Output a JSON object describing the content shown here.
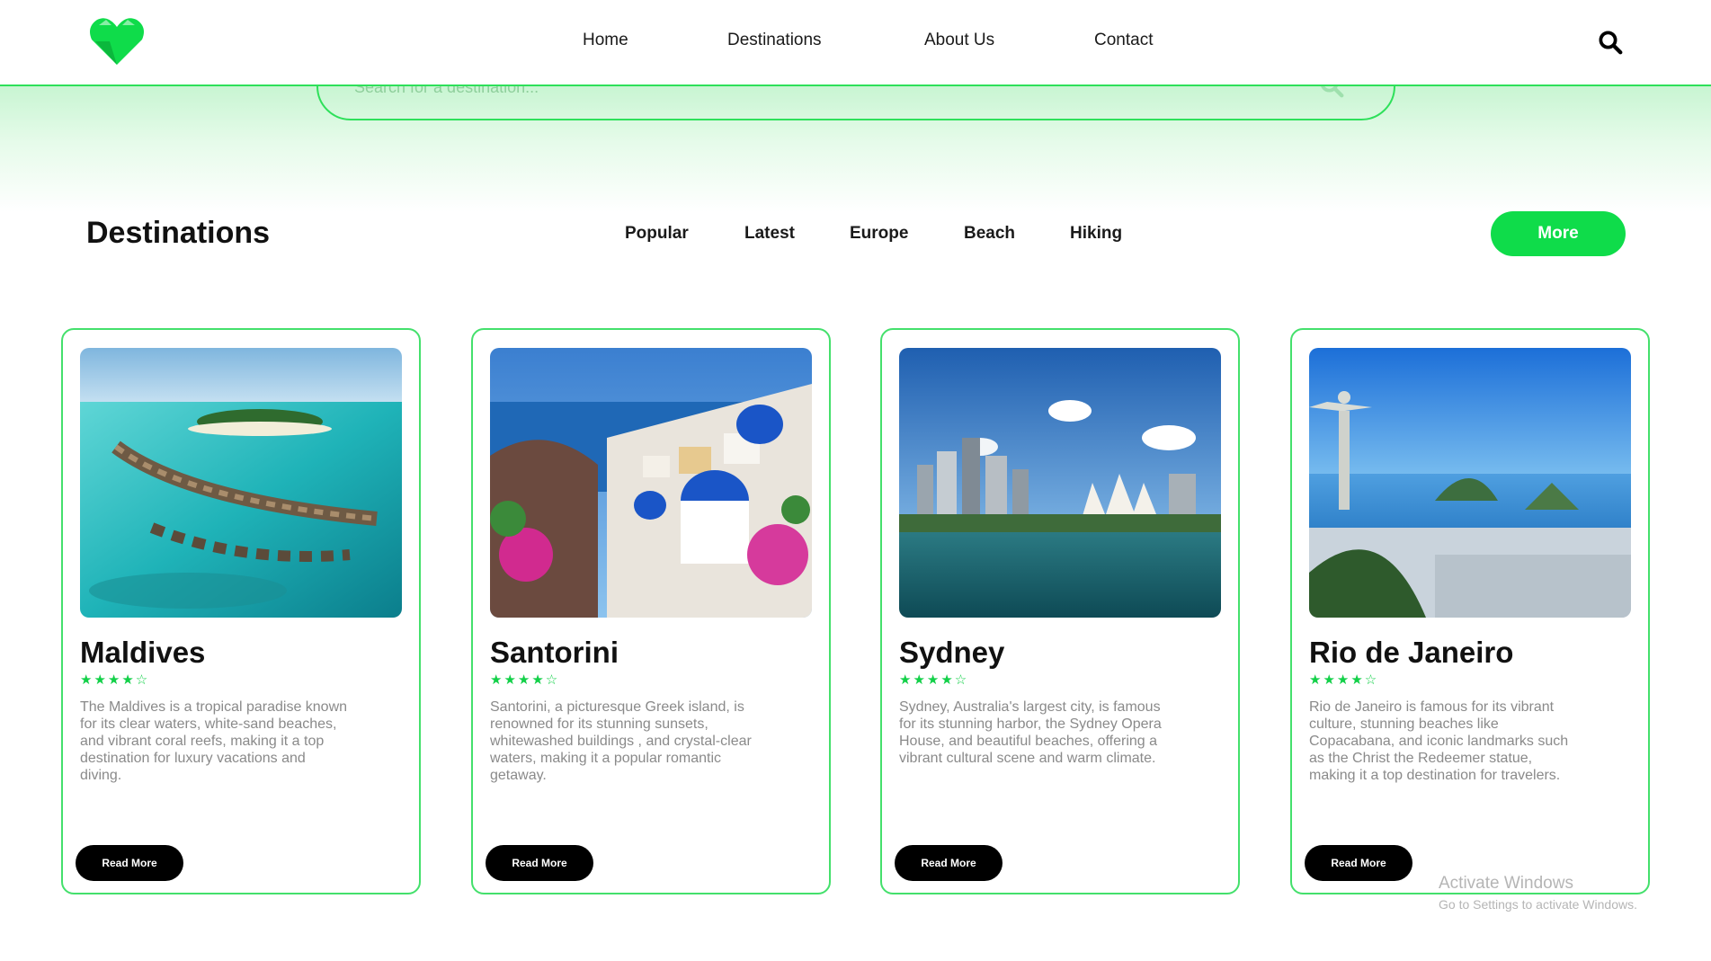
{
  "header": {
    "logo_icon": "green-heart-logo",
    "nav": [
      "Home",
      "Destinations",
      "About Us",
      "Contact"
    ],
    "search_icon": "search-icon"
  },
  "search": {
    "placeholder": "Search for a destination..."
  },
  "section": {
    "title": "Destinations",
    "filters": [
      "Popular",
      "Latest",
      "Europe",
      "Beach",
      "Hiking"
    ],
    "more_label": "More"
  },
  "cards": [
    {
      "name": "Maldives",
      "rating": 4,
      "stars": "★★★★☆",
      "description": "The Maldives is a tropical paradise known for its clear waters, white-sand beaches, and vibrant coral reefs, making it a top destination for luxury vacations and diving.",
      "button": "Read More",
      "image": "maldives-overwater-villas"
    },
    {
      "name": "Santorini",
      "rating": 4,
      "stars": "★★★★☆",
      "description": "Santorini, a picturesque Greek island, is renowned for its stunning sunsets, whitewashed buildings , and crystal-clear waters, making it a popular romantic getaway.",
      "button": "Read More",
      "image": "santorini-blue-domes"
    },
    {
      "name": "Sydney",
      "rating": 4,
      "stars": "★★★★☆",
      "description": "Sydney, Australia's largest city, is famous for its stunning harbor, the Sydney Opera House, and beautiful beaches, offering a vibrant cultural scene and warm climate.",
      "button": "Read More",
      "image": "sydney-opera-house"
    },
    {
      "name": "Rio de Janeiro",
      "rating": 4,
      "stars": "★★★★☆",
      "description": "Rio de Janeiro is famous for its vibrant culture, stunning beaches like Copacabana, and iconic landmarks such as the Christ the Redeemer statue, making it a top destination for travelers.",
      "button": "Read More",
      "image": "rio-christ-redeemer"
    }
  ],
  "watermark": {
    "line1": "Activate Windows",
    "line2": "Go to Settings to activate Windows."
  },
  "colors": {
    "accent": "#0fdc4a",
    "border": "#44e06c",
    "star": "#12d048",
    "button_dark": "#000000"
  }
}
